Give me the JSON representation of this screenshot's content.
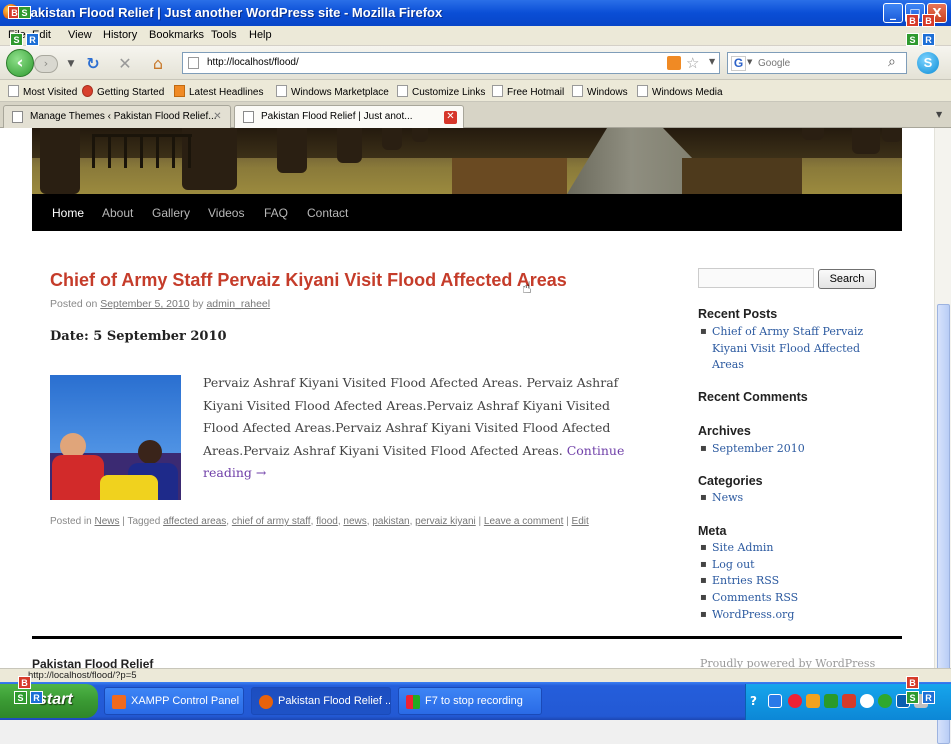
{
  "window": {
    "title": "Pakistan Flood Relief | Just another WordPress site - Mozilla Firefox",
    "minimize": "_",
    "maximize": "□",
    "close": "X"
  },
  "menu": [
    "File",
    "Edit",
    "View",
    "History",
    "Bookmarks",
    "Tools",
    "Help"
  ],
  "nav": {
    "url": "http://localhost/flood/",
    "search_placeholder": "Google"
  },
  "bookmarks": [
    "Most Visited",
    "Getting Started",
    "Latest Headlines",
    "Windows Marketplace",
    "Customize Links",
    "Free Hotmail",
    "Windows",
    "Windows Media"
  ],
  "tabs": [
    {
      "label": "Manage Themes ‹ Pakistan Flood Relief...",
      "active": false
    },
    {
      "label": "Pakistan Flood Relief | Just anot...",
      "active": true
    }
  ],
  "site": {
    "menu": [
      "Home",
      "About",
      "Gallery",
      "Videos",
      "FAQ",
      "Contact"
    ],
    "post": {
      "title": "Chief of Army Staff Pervaiz Kiyani Visit Flood Affected Areas",
      "meta_prefix": "Posted on",
      "date": "September 5, 2010",
      "by": "by",
      "author": "admin_raheel",
      "date_heading": "Date: 5 September 2010",
      "excerpt": "Pervaiz Ashraf Kiyani Visited Flood Afected Areas. Pervaiz Ashraf Kiyani Visited Flood Afected Areas.Pervaiz Ashraf Kiyani Visited Flood Afected Areas.Pervaiz Ashraf Kiyani Visited Flood Afected Areas.Pervaiz Ashraf Kiyani Visited Flood Afected Areas.",
      "continue": "Continue reading →",
      "posted_in_label": "Posted in",
      "category": "News",
      "tagged_label": "| Tagged",
      "tags": [
        "affected areas",
        "chief of army staff",
        "flood",
        "news",
        "pakistan",
        "pervaiz kiyani"
      ],
      "comment": "Leave a comment",
      "edit": "Edit"
    },
    "sidebar": {
      "search_button": "Search",
      "recent_posts_h": "Recent Posts",
      "recent_posts": [
        "Chief of Army Staff Pervaiz",
        "Kiyani Visit Flood Affected",
        "Areas"
      ],
      "recent_comments_h": "Recent Comments",
      "archives_h": "Archives",
      "archives": [
        "September 2010"
      ],
      "categories_h": "Categories",
      "categories": [
        "News"
      ],
      "meta_h": "Meta",
      "meta": [
        "Site Admin",
        "Log out",
        "Entries RSS",
        "Comments RSS",
        "WordPress.org"
      ]
    },
    "footer_left": "Pakistan Flood Relief",
    "footer_right": "Proudly powered by WordPress"
  },
  "status": "http://localhost/flood/?p=5",
  "taskbar": {
    "start": "start",
    "tasks": [
      "XAMPP Control Panel ...",
      "Pakistan Flood Relief ...",
      "F7 to stop recording"
    ]
  },
  "colors": {
    "post_title": "#c53c2a",
    "link": "#2c5aa0",
    "xp_blue": "#245edb",
    "start_green": "#3a9a33"
  }
}
